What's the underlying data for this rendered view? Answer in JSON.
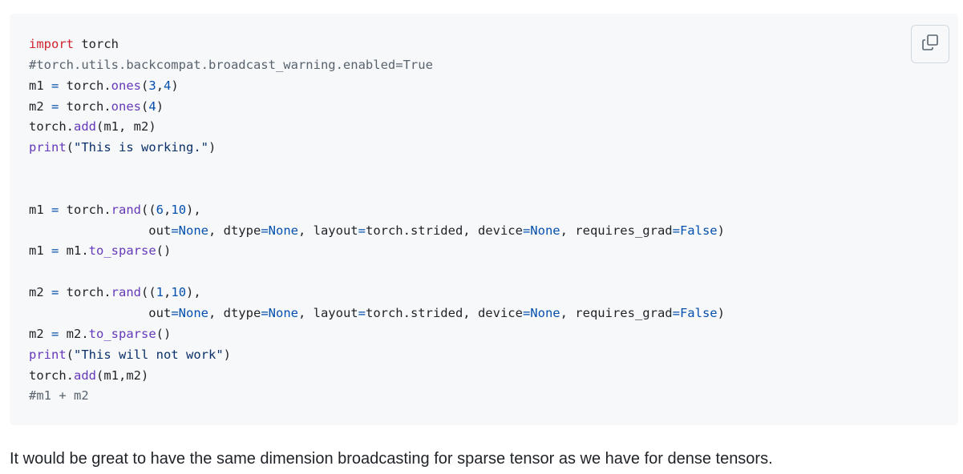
{
  "code_block": {
    "language": "python",
    "copy_button_icon": "copy-icon",
    "lines": [
      [
        {
          "t": "kw",
          "v": "import"
        },
        {
          "t": "",
          "v": " torch"
        }
      ],
      [
        {
          "t": "cm",
          "v": "#torch.utils.backcompat.broadcast_warning.enabled=True"
        }
      ],
      [
        {
          "t": "",
          "v": "m1 "
        },
        {
          "t": "op",
          "v": "="
        },
        {
          "t": "",
          "v": " torch."
        },
        {
          "t": "fn",
          "v": "ones"
        },
        {
          "t": "",
          "v": "("
        },
        {
          "t": "num",
          "v": "3"
        },
        {
          "t": "",
          "v": ","
        },
        {
          "t": "num",
          "v": "4"
        },
        {
          "t": "",
          "v": ")"
        }
      ],
      [
        {
          "t": "",
          "v": "m2 "
        },
        {
          "t": "op",
          "v": "="
        },
        {
          "t": "",
          "v": " torch."
        },
        {
          "t": "fn",
          "v": "ones"
        },
        {
          "t": "",
          "v": "("
        },
        {
          "t": "num",
          "v": "4"
        },
        {
          "t": "",
          "v": ")"
        }
      ],
      [
        {
          "t": "",
          "v": "torch."
        },
        {
          "t": "fn",
          "v": "add"
        },
        {
          "t": "",
          "v": "(m1, m2)"
        }
      ],
      [
        {
          "t": "fn",
          "v": "print"
        },
        {
          "t": "",
          "v": "("
        },
        {
          "t": "str",
          "v": "\"This is working.\""
        },
        {
          "t": "",
          "v": ")"
        }
      ],
      [],
      [],
      [
        {
          "t": "",
          "v": "m1 "
        },
        {
          "t": "op",
          "v": "="
        },
        {
          "t": "",
          "v": " torch."
        },
        {
          "t": "fn",
          "v": "rand"
        },
        {
          "t": "",
          "v": "(("
        },
        {
          "t": "num",
          "v": "6"
        },
        {
          "t": "",
          "v": ","
        },
        {
          "t": "num",
          "v": "10"
        },
        {
          "t": "",
          "v": "),"
        }
      ],
      [
        {
          "t": "",
          "v": "                out"
        },
        {
          "t": "op",
          "v": "="
        },
        {
          "t": "num",
          "v": "None"
        },
        {
          "t": "",
          "v": ", dtype"
        },
        {
          "t": "op",
          "v": "="
        },
        {
          "t": "num",
          "v": "None"
        },
        {
          "t": "",
          "v": ", layout"
        },
        {
          "t": "op",
          "v": "="
        },
        {
          "t": "",
          "v": "torch.strided, device"
        },
        {
          "t": "op",
          "v": "="
        },
        {
          "t": "num",
          "v": "None"
        },
        {
          "t": "",
          "v": ", requires_grad"
        },
        {
          "t": "op",
          "v": "="
        },
        {
          "t": "num",
          "v": "False"
        },
        {
          "t": "",
          "v": ")"
        }
      ],
      [
        {
          "t": "",
          "v": "m1 "
        },
        {
          "t": "op",
          "v": "="
        },
        {
          "t": "",
          "v": " m1."
        },
        {
          "t": "fn",
          "v": "to_sparse"
        },
        {
          "t": "",
          "v": "()"
        }
      ],
      [],
      [
        {
          "t": "",
          "v": "m2 "
        },
        {
          "t": "op",
          "v": "="
        },
        {
          "t": "",
          "v": " torch."
        },
        {
          "t": "fn",
          "v": "rand"
        },
        {
          "t": "",
          "v": "(("
        },
        {
          "t": "num",
          "v": "1"
        },
        {
          "t": "",
          "v": ","
        },
        {
          "t": "num",
          "v": "10"
        },
        {
          "t": "",
          "v": "),"
        }
      ],
      [
        {
          "t": "",
          "v": "                out"
        },
        {
          "t": "op",
          "v": "="
        },
        {
          "t": "num",
          "v": "None"
        },
        {
          "t": "",
          "v": ", dtype"
        },
        {
          "t": "op",
          "v": "="
        },
        {
          "t": "num",
          "v": "None"
        },
        {
          "t": "",
          "v": ", layout"
        },
        {
          "t": "op",
          "v": "="
        },
        {
          "t": "",
          "v": "torch.strided, device"
        },
        {
          "t": "op",
          "v": "="
        },
        {
          "t": "num",
          "v": "None"
        },
        {
          "t": "",
          "v": ", requires_grad"
        },
        {
          "t": "op",
          "v": "="
        },
        {
          "t": "num",
          "v": "False"
        },
        {
          "t": "",
          "v": ")"
        }
      ],
      [
        {
          "t": "",
          "v": "m2 "
        },
        {
          "t": "op",
          "v": "="
        },
        {
          "t": "",
          "v": " m2."
        },
        {
          "t": "fn",
          "v": "to_sparse"
        },
        {
          "t": "",
          "v": "()"
        }
      ],
      [
        {
          "t": "fn",
          "v": "print"
        },
        {
          "t": "",
          "v": "("
        },
        {
          "t": "str",
          "v": "\"This will not work\""
        },
        {
          "t": "",
          "v": ")"
        }
      ],
      [
        {
          "t": "",
          "v": "torch."
        },
        {
          "t": "fn",
          "v": "add"
        },
        {
          "t": "",
          "v": "(m1,m2)"
        }
      ],
      [
        {
          "t": "cm",
          "v": "#m1 + m2"
        }
      ]
    ]
  },
  "comment_text": "It would be great to have the same dimension broadcasting for sparse tensor as we have for dense tensors."
}
